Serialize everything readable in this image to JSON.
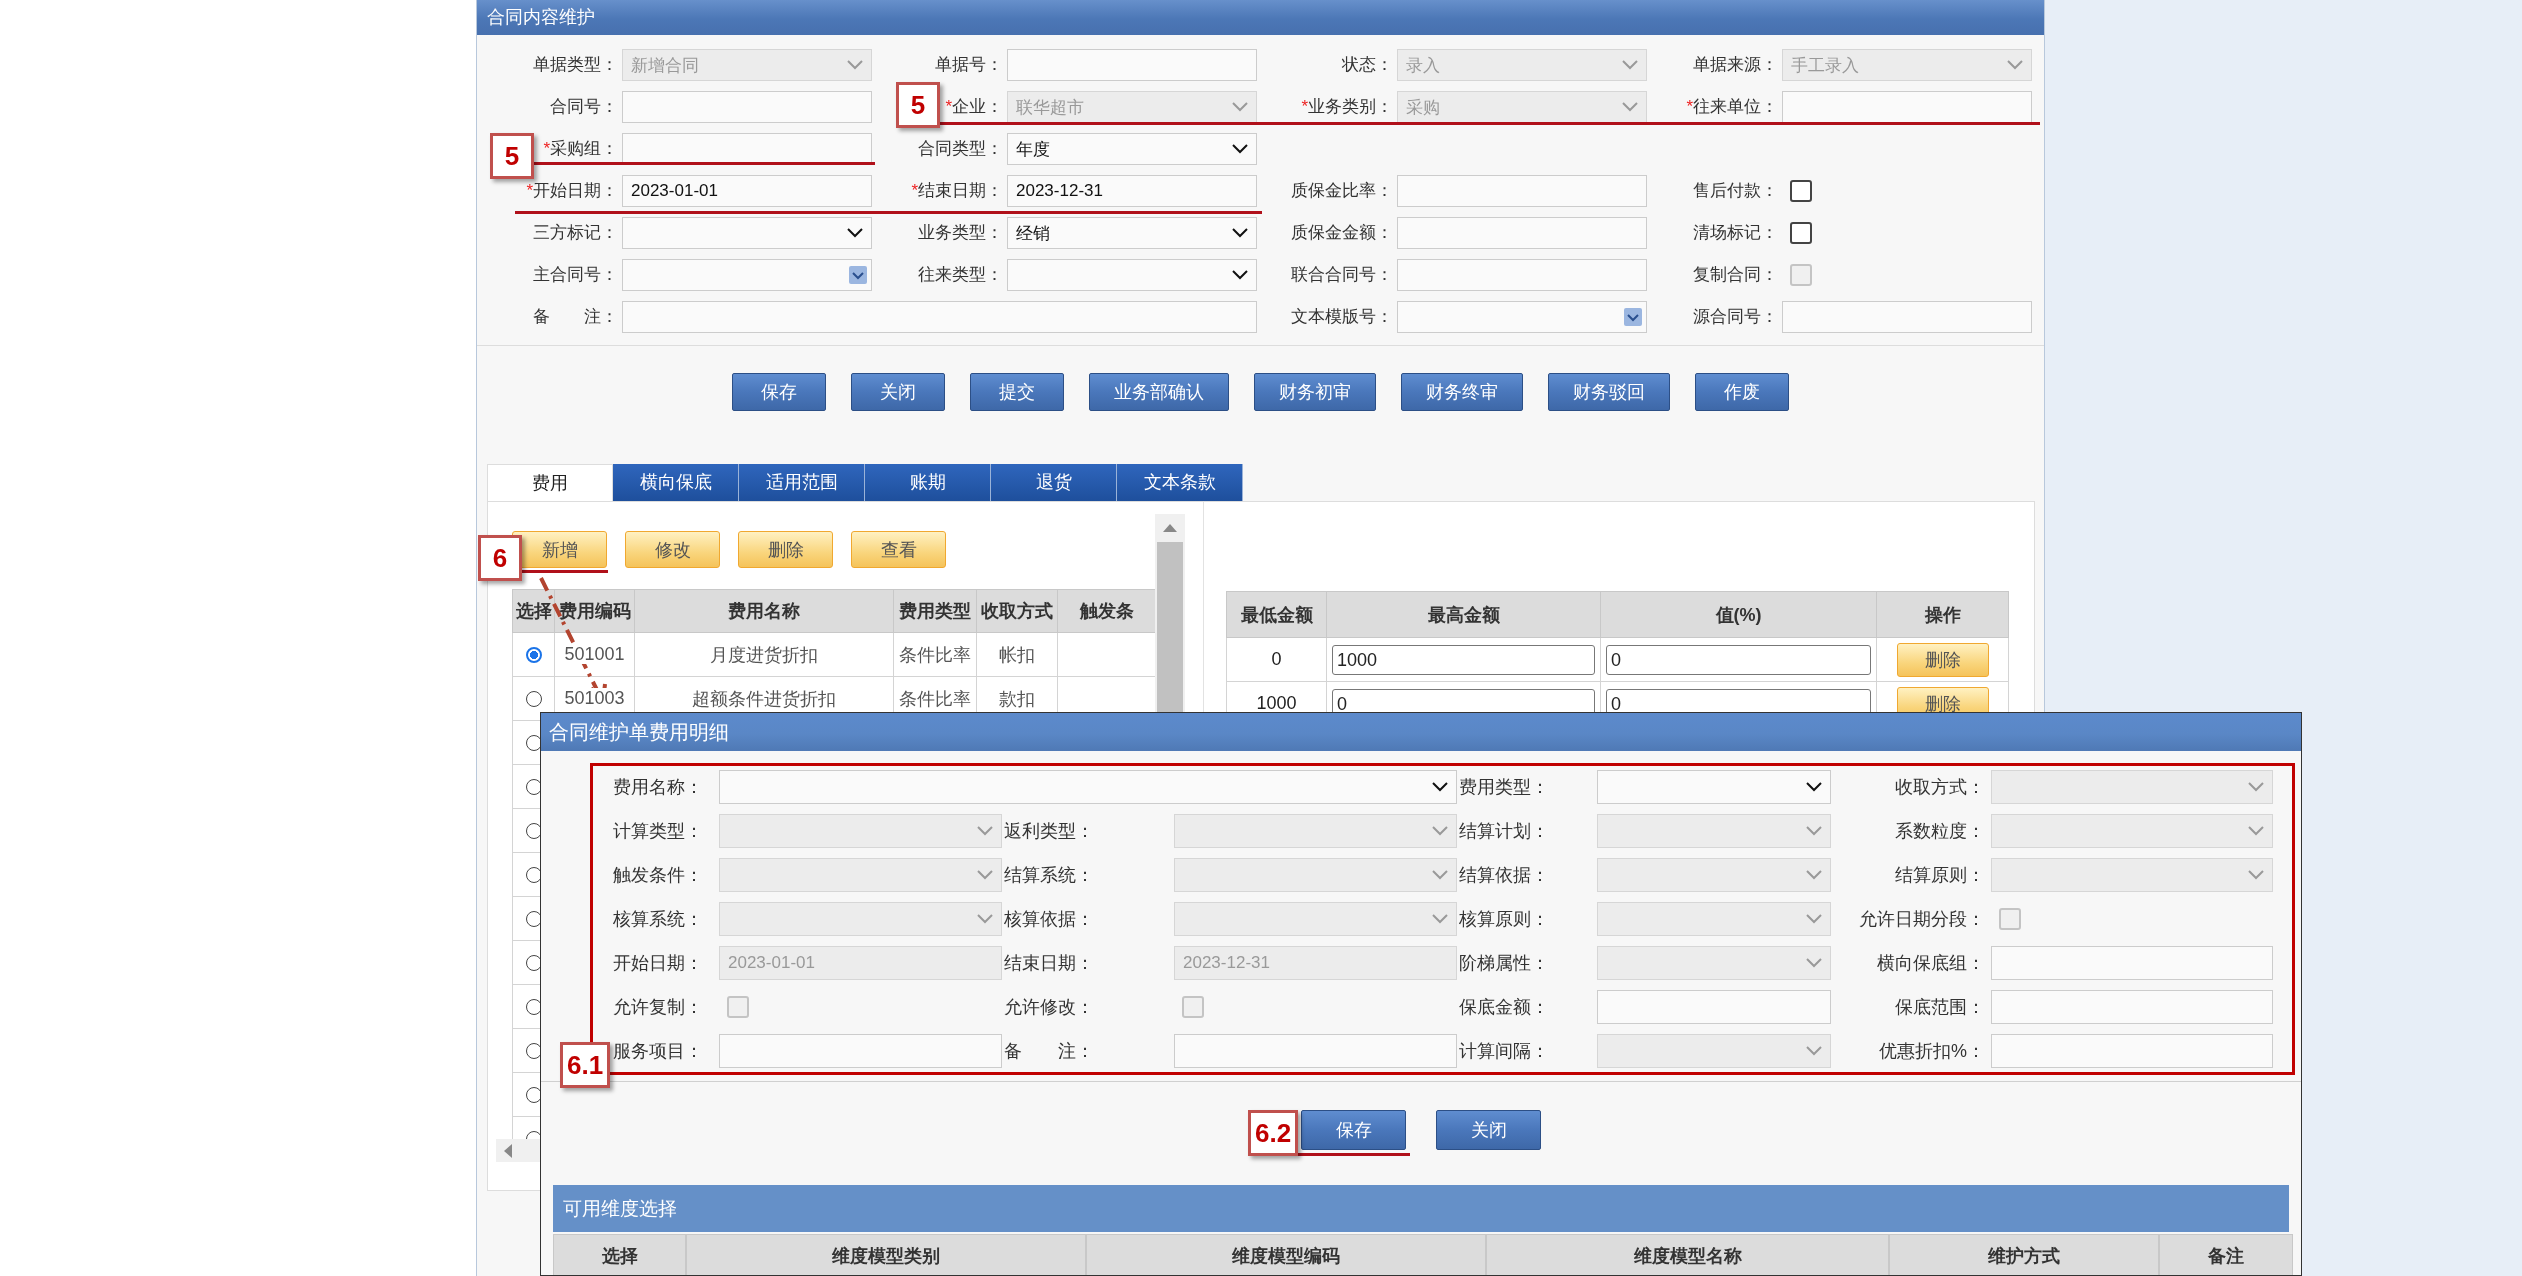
{
  "window": {
    "title": "合同内容维护"
  },
  "form": {
    "rows": [
      [
        {
          "label": "单据类型：",
          "kind": "select",
          "value": "新增合同",
          "disabled": true
        },
        {
          "label": "单据号：",
          "kind": "input",
          "disabled": false
        },
        {
          "label": "状态：",
          "kind": "select",
          "value": "录入",
          "disabled": true
        },
        {
          "label": "单据来源：",
          "kind": "select",
          "value": "手工录入",
          "disabled": true
        }
      ],
      [
        {
          "label": "合同号：",
          "kind": "input",
          "disabled": false
        },
        {
          "mark": "*",
          "label": "企业：",
          "kind": "select",
          "value": "联华超市",
          "disabled": true
        },
        {
          "mark": "*",
          "label": "业务类别：",
          "kind": "select",
          "value": "采购",
          "disabled": true
        },
        {
          "mark": "*",
          "label": "往来单位：",
          "kind": "input",
          "disabled": false
        }
      ],
      [
        {
          "mark": "*",
          "label": "采购组：",
          "kind": "input",
          "disabled": false
        },
        {
          "label": "合同类型：",
          "kind": "select",
          "value": "年度",
          "disabled": false
        }
      ],
      [
        {
          "mark": "*",
          "label": "开始日期：",
          "kind": "input",
          "value": "2023-01-01",
          "disabled": false
        },
        {
          "mark": "*",
          "label": "结束日期：",
          "kind": "input",
          "value": "2023-12-31",
          "disabled": false
        },
        {
          "label": "质保金比率：",
          "kind": "input",
          "disabled": false
        },
        {
          "label": "售后付款：",
          "kind": "checkbox",
          "checked": false,
          "disabled": false
        }
      ],
      [
        {
          "label": "三方标记：",
          "kind": "select",
          "disabled": false
        },
        {
          "label": "业务类型：",
          "kind": "select",
          "value": "经销",
          "disabled": false
        },
        {
          "label": "质保金金额：",
          "kind": "input",
          "disabled": false
        },
        {
          "label": "清场标记：",
          "kind": "checkbox",
          "checked": false,
          "disabled": false
        }
      ],
      [
        {
          "label": "主合同号：",
          "kind": "combo",
          "disabled": false
        },
        {
          "label": "往来类型：",
          "kind": "select",
          "disabled": false
        },
        {
          "label": "联合合同号：",
          "kind": "input",
          "disabled": false
        },
        {
          "label": "复制合同：",
          "kind": "checkbox",
          "checked": false,
          "disabled": true
        }
      ],
      [
        {
          "label": "备　　注：",
          "kind": "wide",
          "disabled": false
        },
        "",
        {
          "label": "文本模版号：",
          "kind": "combo",
          "disabled": false
        },
        {
          "label": "源合同号：",
          "kind": "input",
          "disabled": false
        }
      ]
    ]
  },
  "actions": [
    "保存",
    "关闭",
    "提交",
    "业务部确认",
    "财务初审",
    "财务终审",
    "财务驳回",
    "作废"
  ],
  "tabs": [
    {
      "label": "费用",
      "selected": true
    },
    {
      "label": "横向保底",
      "selected": false
    },
    {
      "label": "适用范围",
      "selected": false
    },
    {
      "label": "账期",
      "selected": false
    },
    {
      "label": "退货",
      "selected": false
    },
    {
      "label": "文本条款",
      "selected": false
    }
  ],
  "fee_toolbar": [
    "新增",
    "修改",
    "删除",
    "查看"
  ],
  "fee_table": {
    "columns": [
      "选择",
      "费用编码",
      "费用名称",
      "费用类型",
      "收取方式",
      "触发条"
    ],
    "rows": [
      {
        "selected": true,
        "cells": [
          "501001",
          "月度进货折扣",
          "条件比率",
          "帐扣"
        ]
      },
      {
        "selected": false,
        "cells": [
          "501003",
          "超额条件进货折扣",
          "条件比率",
          "款扣"
        ]
      },
      {
        "selected": false
      },
      {
        "selected": false
      },
      {
        "selected": false
      },
      {
        "selected": false
      },
      {
        "selected": false
      },
      {
        "selected": false
      },
      {
        "selected": false
      },
      {
        "selected": false
      },
      {
        "selected": false
      },
      {
        "selected": false
      }
    ]
  },
  "tier_table": {
    "columns": [
      "最低金额",
      "最高金额",
      "值(%)",
      "操作"
    ],
    "rows": [
      {
        "min": "0",
        "max": "1000",
        "value": "0",
        "action": "删除"
      },
      {
        "min": "1000",
        "max": "0",
        "value": "0",
        "action": "删除"
      }
    ]
  },
  "dialog": {
    "title": "合同维护单费用明细",
    "form": {
      "rows": [
        [
          {
            "label": "费用名称：",
            "kind": "wide_select",
            "disabled": false
          },
          "",
          {
            "label": "费用类型：",
            "kind": "select",
            "disabled": false
          },
          {
            "label": "收取方式：",
            "kind": "select",
            "disabled": true
          }
        ],
        [
          {
            "label": "计算类型：",
            "kind": "select",
            "disabled": true
          },
          {
            "label": "返利类型：",
            "kind": "select",
            "disabled": true
          },
          {
            "label": "结算计划：",
            "kind": "select",
            "disabled": true
          },
          {
            "label": "系数粒度：",
            "kind": "select",
            "disabled": true
          }
        ],
        [
          {
            "label": "触发条件：",
            "kind": "select",
            "disabled": true
          },
          {
            "label": "结算系统：",
            "kind": "select",
            "disabled": true
          },
          {
            "label": "结算依据：",
            "kind": "select",
            "disabled": true
          },
          {
            "label": "结算原则：",
            "kind": "select",
            "disabled": true
          }
        ],
        [
          {
            "label": "核算系统：",
            "kind": "select",
            "disabled": true
          },
          {
            "label": "核算依据：",
            "kind": "select",
            "disabled": true
          },
          {
            "label": "核算原则：",
            "kind": "select",
            "disabled": true
          },
          {
            "label": "允许日期分段：",
            "kind": "checkbox",
            "checked": false,
            "disabled": true
          }
        ],
        [
          {
            "label": "开始日期：",
            "kind": "input",
            "value": "2023-01-01",
            "disabled": true
          },
          {
            "label": "结束日期：",
            "kind": "input",
            "value": "2023-12-31",
            "disabled": true
          },
          {
            "label": "阶梯属性：",
            "kind": "select",
            "disabled": true
          },
          {
            "label": "横向保底组：",
            "kind": "input",
            "disabled": false
          }
        ],
        [
          {
            "label": "允许复制：",
            "kind": "checkbox",
            "checked": false,
            "disabled": true
          },
          {
            "label": "允许修改：",
            "kind": "checkbox",
            "checked": false,
            "disabled": true
          },
          {
            "label": "保底金额：",
            "kind": "input",
            "disabled": false
          },
          {
            "label": "保底范围：",
            "kind": "input",
            "disabled": false
          }
        ],
        [
          {
            "label": "服务项目：",
            "kind": "input",
            "disabled": false
          },
          {
            "label": "备　　注：",
            "kind": "input",
            "disabled": false
          },
          {
            "label": "计算间隔：",
            "kind": "select",
            "disabled": true
          },
          {
            "label": "优惠折扣%：",
            "kind": "input",
            "disabled": false
          }
        ]
      ]
    },
    "buttons": [
      "保存",
      "关闭"
    ],
    "section": {
      "title": "可用维度选择",
      "columns": [
        "选择",
        "维度模型类别",
        "维度模型编码",
        "维度模型名称",
        "维护方式",
        "备注"
      ]
    }
  },
  "annotations": [
    {
      "label": "5"
    },
    {
      "label": "5"
    },
    {
      "label": "6"
    },
    {
      "label": "6.1"
    },
    {
      "label": "6.2"
    }
  ]
}
